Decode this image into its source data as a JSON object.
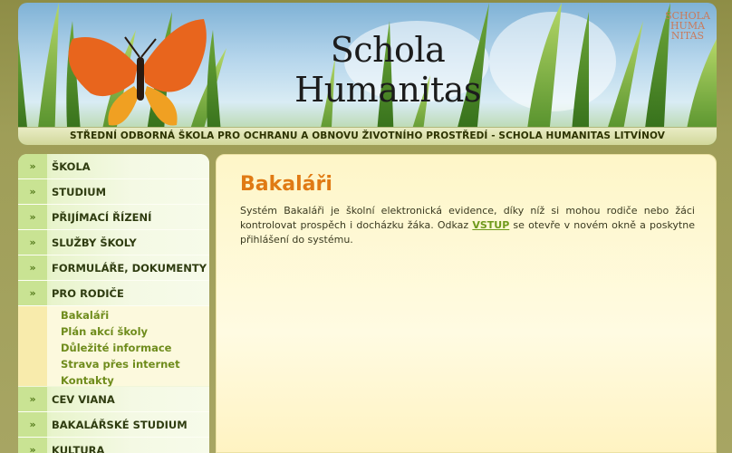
{
  "header": {
    "site_title": "Schola Humanitas",
    "logo_lines": [
      "SCHOLA",
      "HUMA",
      "NITAS"
    ],
    "subtitle": "STŘEDNÍ ODBORNÁ ŠKOLA PRO OCHRANU A OBNOVU ŽIVOTNÍHO PROSTŘEDÍ - SCHOLA HUMANITAS LITVÍNOV"
  },
  "sidebar": {
    "arrow": "»",
    "items": [
      {
        "label": "ŠKOLA"
      },
      {
        "label": "STUDIUM"
      },
      {
        "label": "PŘIJÍMACÍ ŘÍZENÍ"
      },
      {
        "label": "SLUŽBY ŠKOLY"
      },
      {
        "label": "FORMULÁŘE, DOKUMENTY"
      },
      {
        "label": "PRO RODIČE"
      },
      {
        "label": "CEV VIANA"
      },
      {
        "label": "BAKALÁŘSKÉ STUDIUM"
      },
      {
        "label": "KULTURA"
      }
    ],
    "sub_items": [
      {
        "label": "Bakaláři"
      },
      {
        "label": "Plán akcí školy"
      },
      {
        "label": "Důležité informace"
      },
      {
        "label": "Strava přes internet"
      },
      {
        "label": "Kontakty"
      }
    ]
  },
  "main": {
    "title": "Bakaláři",
    "text_before": "Systém Bakaláři je školní elektronická evidence, díky níž si mohou rodiče nebo žáci kontrolovat prospěch i docházku žáka. Odkaz ",
    "link": "VSTUP",
    "text_after": " se otevře v novém okně a poskytne přihlášení do systému."
  },
  "colors": {
    "accent_orange": "#e07a14",
    "link_green": "#6f9a1c",
    "nav_green": "#c9e393"
  }
}
